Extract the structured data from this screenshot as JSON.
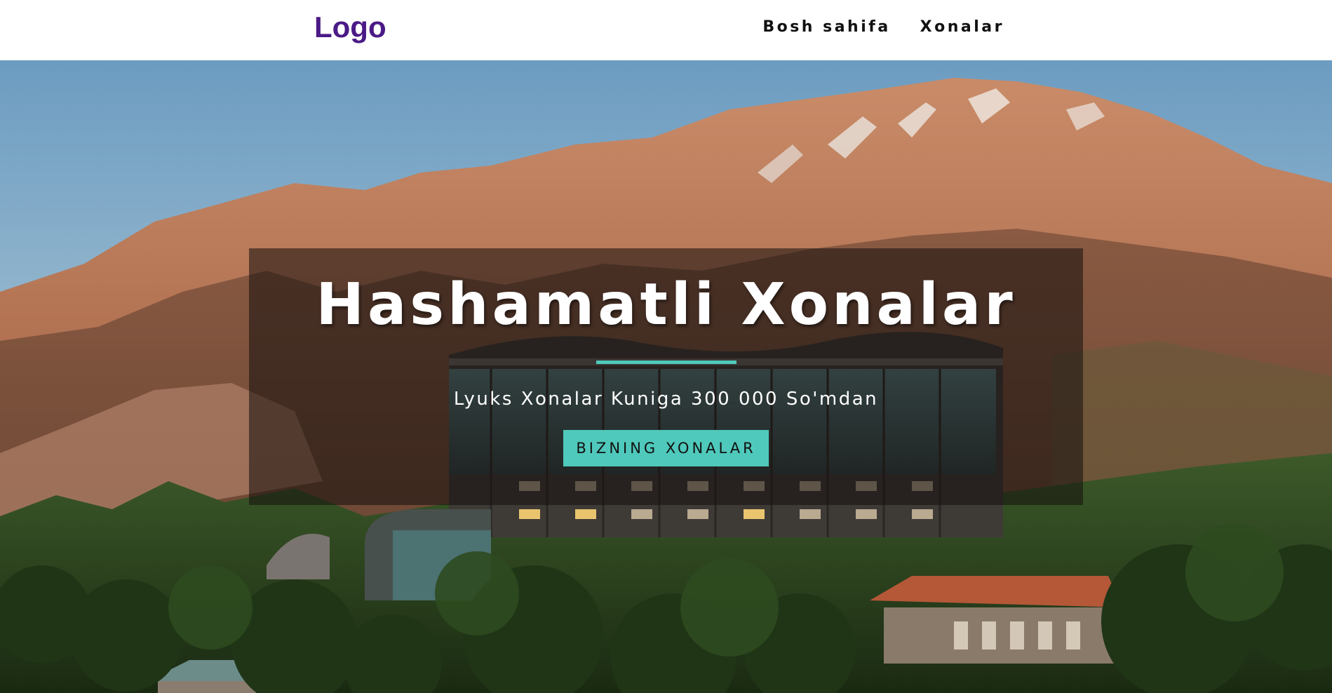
{
  "header": {
    "logo": "Logo",
    "nav": [
      {
        "label": "Bosh sahifa"
      },
      {
        "label": "Xonalar"
      }
    ]
  },
  "hero": {
    "title": "Hashamatli Xonalar",
    "subtitle": "Lyuks Xonalar Kuniga 300 000 So'mdan",
    "cta_label": "BIZNING XONALAR",
    "background_image": "mountain-hotel-photo",
    "accent_color": "#4fc9bb"
  },
  "colors": {
    "logo": "#4b1a86",
    "nav_text": "#111111",
    "accent": "#4fc9bb",
    "overlay": "rgba(20,14,12,0.55)"
  }
}
